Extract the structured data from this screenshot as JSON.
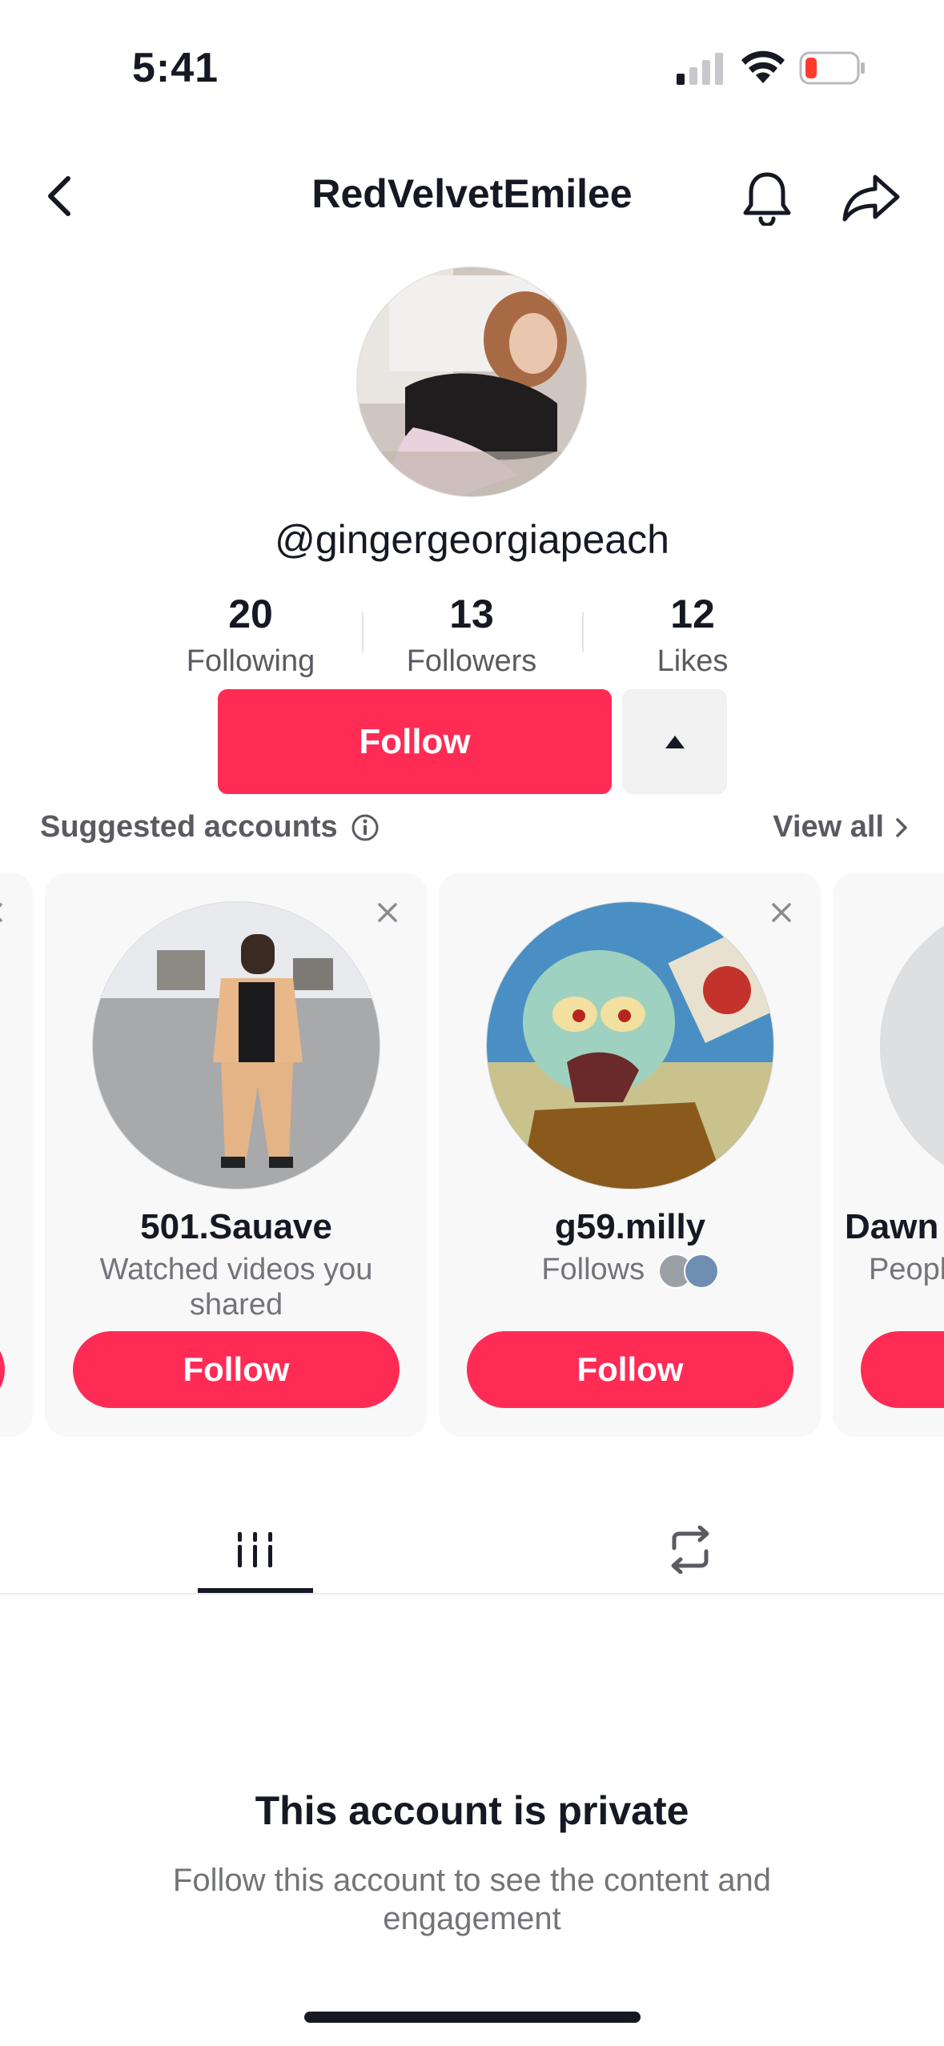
{
  "status_bar": {
    "time": "5:41"
  },
  "header": {
    "title": "RedVelvetEmilee"
  },
  "profile": {
    "handle": "@gingergeorgiapeach",
    "stats": [
      {
        "value": "20",
        "label": "Following"
      },
      {
        "value": "13",
        "label": "Followers"
      },
      {
        "value": "12",
        "label": "Likes"
      }
    ],
    "follow_label": "Follow"
  },
  "suggested": {
    "title": "Suggested accounts",
    "view_all": "View all",
    "cards": [
      {
        "name": "501.Sauave",
        "subtitle": "Watched videos you shared",
        "follow_label": "Follow"
      },
      {
        "name": "g59.milly",
        "subtitle": "Follows",
        "follow_label": "Follow"
      },
      {
        "name": "Dawn",
        "subtitle": "Peopl",
        "follow_label": ""
      }
    ]
  },
  "private": {
    "title": "This account is private",
    "description": "Follow this account to see the content and engagement"
  },
  "colors": {
    "accent": "#fe2c55",
    "text": "#161823",
    "muted": "#73747a"
  }
}
